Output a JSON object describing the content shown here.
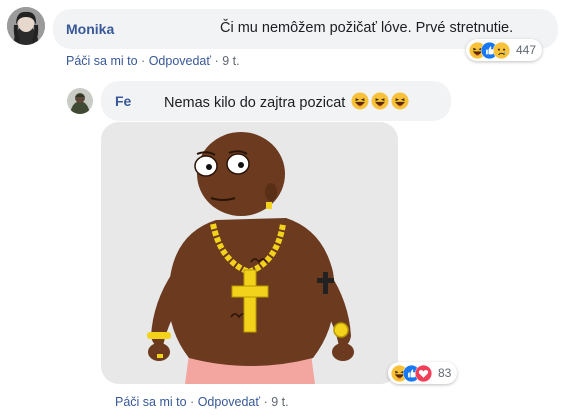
{
  "comments": [
    {
      "author": "Monika",
      "text": "Či mu nemôžem požičať lóve. Prvé stretnutie.",
      "reaction_count": "447",
      "reactions": [
        "haha-icon",
        "like-icon",
        "sad-icon"
      ],
      "actions": {
        "like": "Páči sa mi to",
        "reply": "Odpovedať",
        "time": "9 t."
      }
    },
    {
      "author": "Fe",
      "text": "Nemas kilo do zajtra pozicat",
      "inline_emoji": [
        "laughing-emoji",
        "laughing-emoji",
        "laughing-emoji"
      ],
      "attachment": "cartoon-man-gold-chain-image",
      "reaction_count": "83",
      "reactions": [
        "haha-icon",
        "like-icon",
        "love-icon"
      ],
      "actions": {
        "like": "Páči sa mi to",
        "reply": "Odpovedať",
        "time": "9 t."
      }
    }
  ],
  "colors": {
    "author": "#385898",
    "bubble": "#f2f3f5",
    "meta": "#606770",
    "like": "#1877f2",
    "love": "#f33e58",
    "haha": "#f7b125"
  },
  "separator": "·"
}
